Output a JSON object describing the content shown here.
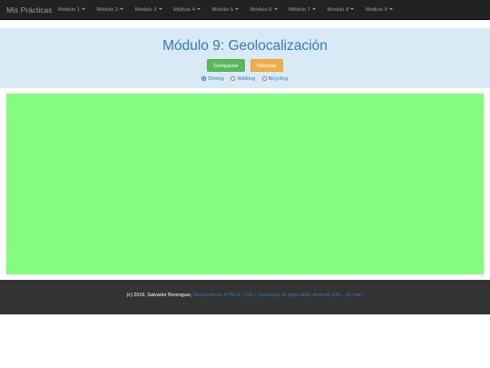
{
  "navbar": {
    "brand": "Mis Prácticas",
    "items": [
      {
        "label": "Módulo 1"
      },
      {
        "label": "Módulo 2"
      },
      {
        "label": "Módulo 3"
      },
      {
        "label": "Módulo 4"
      },
      {
        "label": "Módulo 5"
      },
      {
        "label": "Módulo 6"
      },
      {
        "label": "Módulo 7"
      },
      {
        "label": "Módulo 8"
      },
      {
        "label": "Módulo 9"
      }
    ]
  },
  "header": {
    "title": "Módulo 9: Geolocalización",
    "compact_label": "Compactar",
    "reset_label": "Reiniciar",
    "modes": [
      {
        "label": "Driving",
        "checked": true
      },
      {
        "label": "Walking",
        "checked": false
      },
      {
        "label": "Bicycling",
        "checked": false
      }
    ]
  },
  "map": {
    "color": "#82fd80"
  },
  "footer": {
    "copyright": "(c) 2016, Salvador Berenguer,",
    "course_link": "Desarrollo en HTML5, CSS y Javascript de Apps Web, Android, IOS... (9.ª ed.)"
  },
  "colors": {
    "navbar_bg": "#222222",
    "jumbotron_bg": "#d9eaf7",
    "title": "#337ab7",
    "success": "#5cb85c",
    "warning": "#f0ad4e",
    "footer_bg": "#333333"
  }
}
